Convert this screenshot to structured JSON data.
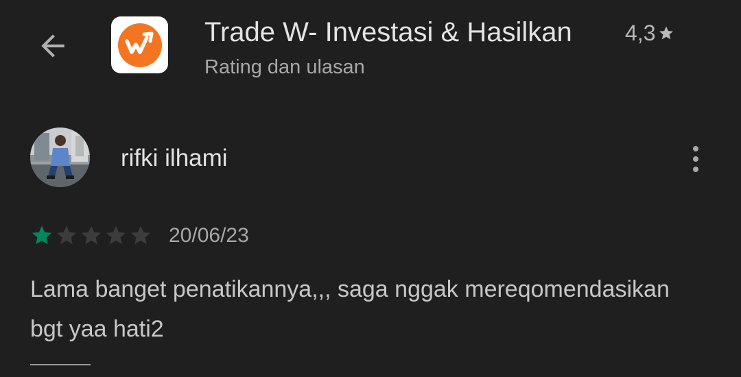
{
  "header": {
    "back_icon": "arrow-back-icon",
    "app_icon": "trade-w-logo-icon",
    "app_title": "Trade W- Investasi & Hasilkan",
    "rating": "4,3",
    "rating_icon": "star-icon",
    "subtitle": "Rating dan ulasan"
  },
  "review": {
    "author": "rifki ilhami",
    "avatar": "user-avatar",
    "more_icon": "more-vert-icon",
    "stars_filled": 1,
    "stars_total": 5,
    "date": "20/06/23",
    "text": "Lama banget penatikannya,,, saga nggak mereqomendasikan bgt yaa hati2"
  },
  "colors": {
    "background": "#1f1f1f",
    "star_filled": "#01875f",
    "star_empty": "#3c3c3c",
    "brand_orange": "#f47521"
  }
}
